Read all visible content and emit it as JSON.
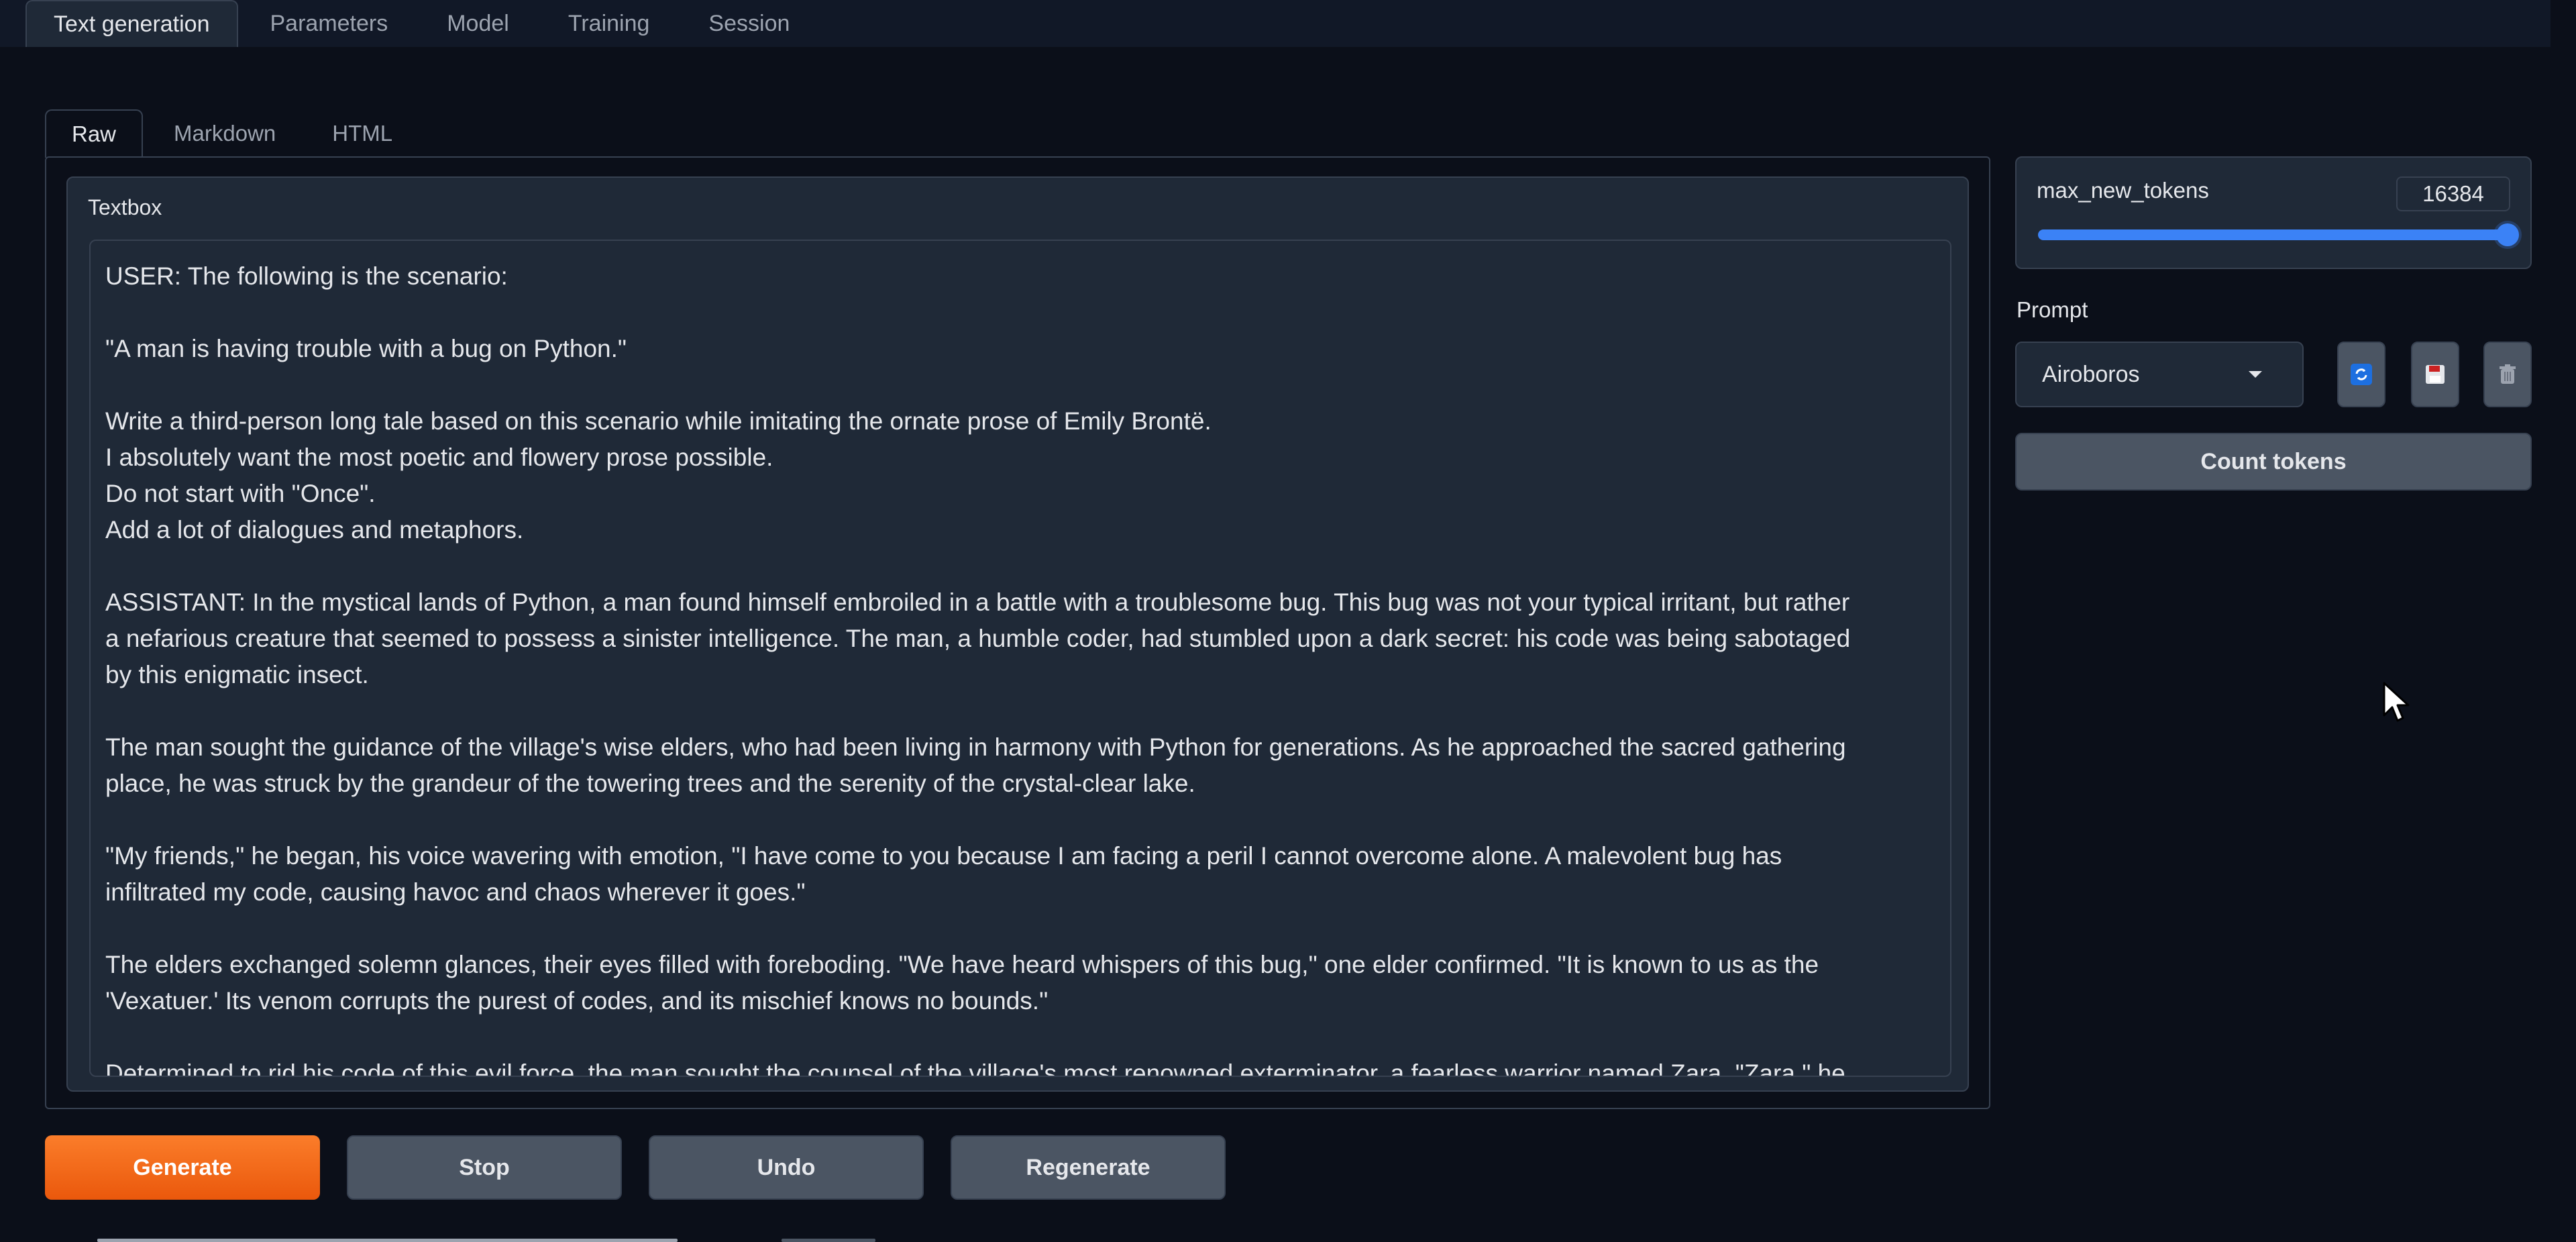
{
  "top_tabs": [
    "Text generation",
    "Parameters",
    "Model",
    "Training",
    "Session"
  ],
  "sub_tabs": [
    "Raw",
    "Markdown",
    "HTML"
  ],
  "textbox": {
    "label": "Textbox",
    "lines": [
      "USER: The following is the scenario:",
      "",
      "\"A man is having trouble with a bug on Python.\"",
      "",
      "Write a third-person long tale based on this scenario while imitating the ornate prose of Emily Brontë.",
      "I absolutely want the most poetic and flowery prose possible.",
      "Do not start with \"Once\".",
      "Add a lot of dialogues and metaphors.",
      "",
      "ASSISTANT: In the mystical lands of Python, a man found himself embroiled in a battle with a troublesome bug. This bug was not your typical irritant, but rather",
      "a nefarious creature that seemed to possess a sinister intelligence. The man, a humble coder, had stumbled upon a dark secret: his code was being sabotaged",
      "by this enigmatic insect.",
      "",
      "The man sought the guidance of the village's wise elders, who had been living in harmony with Python for generations. As he approached the sacred gathering",
      "place, he was struck by the grandeur of the towering trees and the serenity of the crystal-clear lake.",
      "",
      "\"My friends,\" he began, his voice wavering with emotion, \"I have come to you because I am facing a peril I cannot overcome alone. A malevolent bug has",
      "infiltrated my code, causing havoc and chaos wherever it goes.\"",
      "",
      "The elders exchanged solemn glances, their eyes filled with foreboding. \"We have heard whispers of this bug,\" one elder confirmed. \"It is known to us as the",
      "'Vexatuer.' Its venom corrupts the purest of codes, and its mischief knows no bounds.\"",
      "",
      "Determined to rid his code of this evil force, the man sought the counsel of the village's most renowned exterminator, a fearless warrior named Zara. \"Zara,\" he"
    ]
  },
  "slider": {
    "label": "max_new_tokens",
    "value": "16384",
    "fraction": 1.0
  },
  "prompt": {
    "label": "Prompt",
    "selected": "Airoboros"
  },
  "count_tokens_label": "Count tokens",
  "actions": {
    "generate": "Generate",
    "stop": "Stop",
    "undo": "Undo",
    "regenerate": "Regenerate"
  },
  "colors": {
    "accent": "#3b82f6",
    "generate": "#f97316"
  }
}
